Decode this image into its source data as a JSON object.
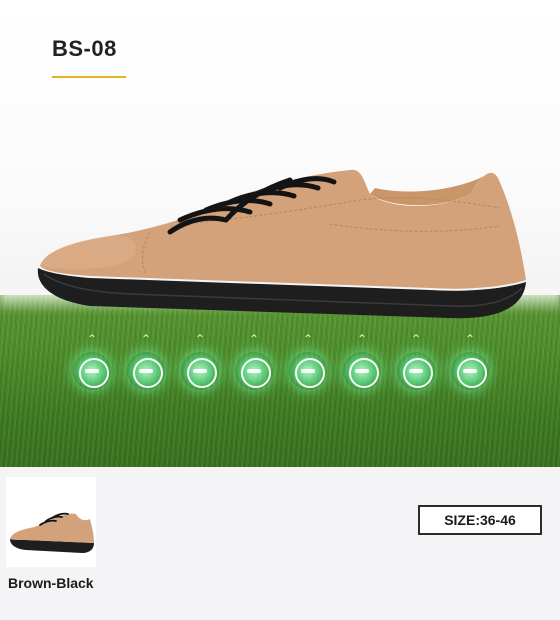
{
  "product": {
    "model": "BS-08",
    "accent_color": "#e5b323"
  },
  "hero": {
    "shoe_color": "#d4a27a",
    "sole_color": "#1e1e1e",
    "sensor_count": 8,
    "sensor_icon": "pressure-point-icon",
    "background": "grass"
  },
  "variant": {
    "label": "Brown-Black"
  },
  "size": {
    "label": "SIZE:36-46"
  }
}
